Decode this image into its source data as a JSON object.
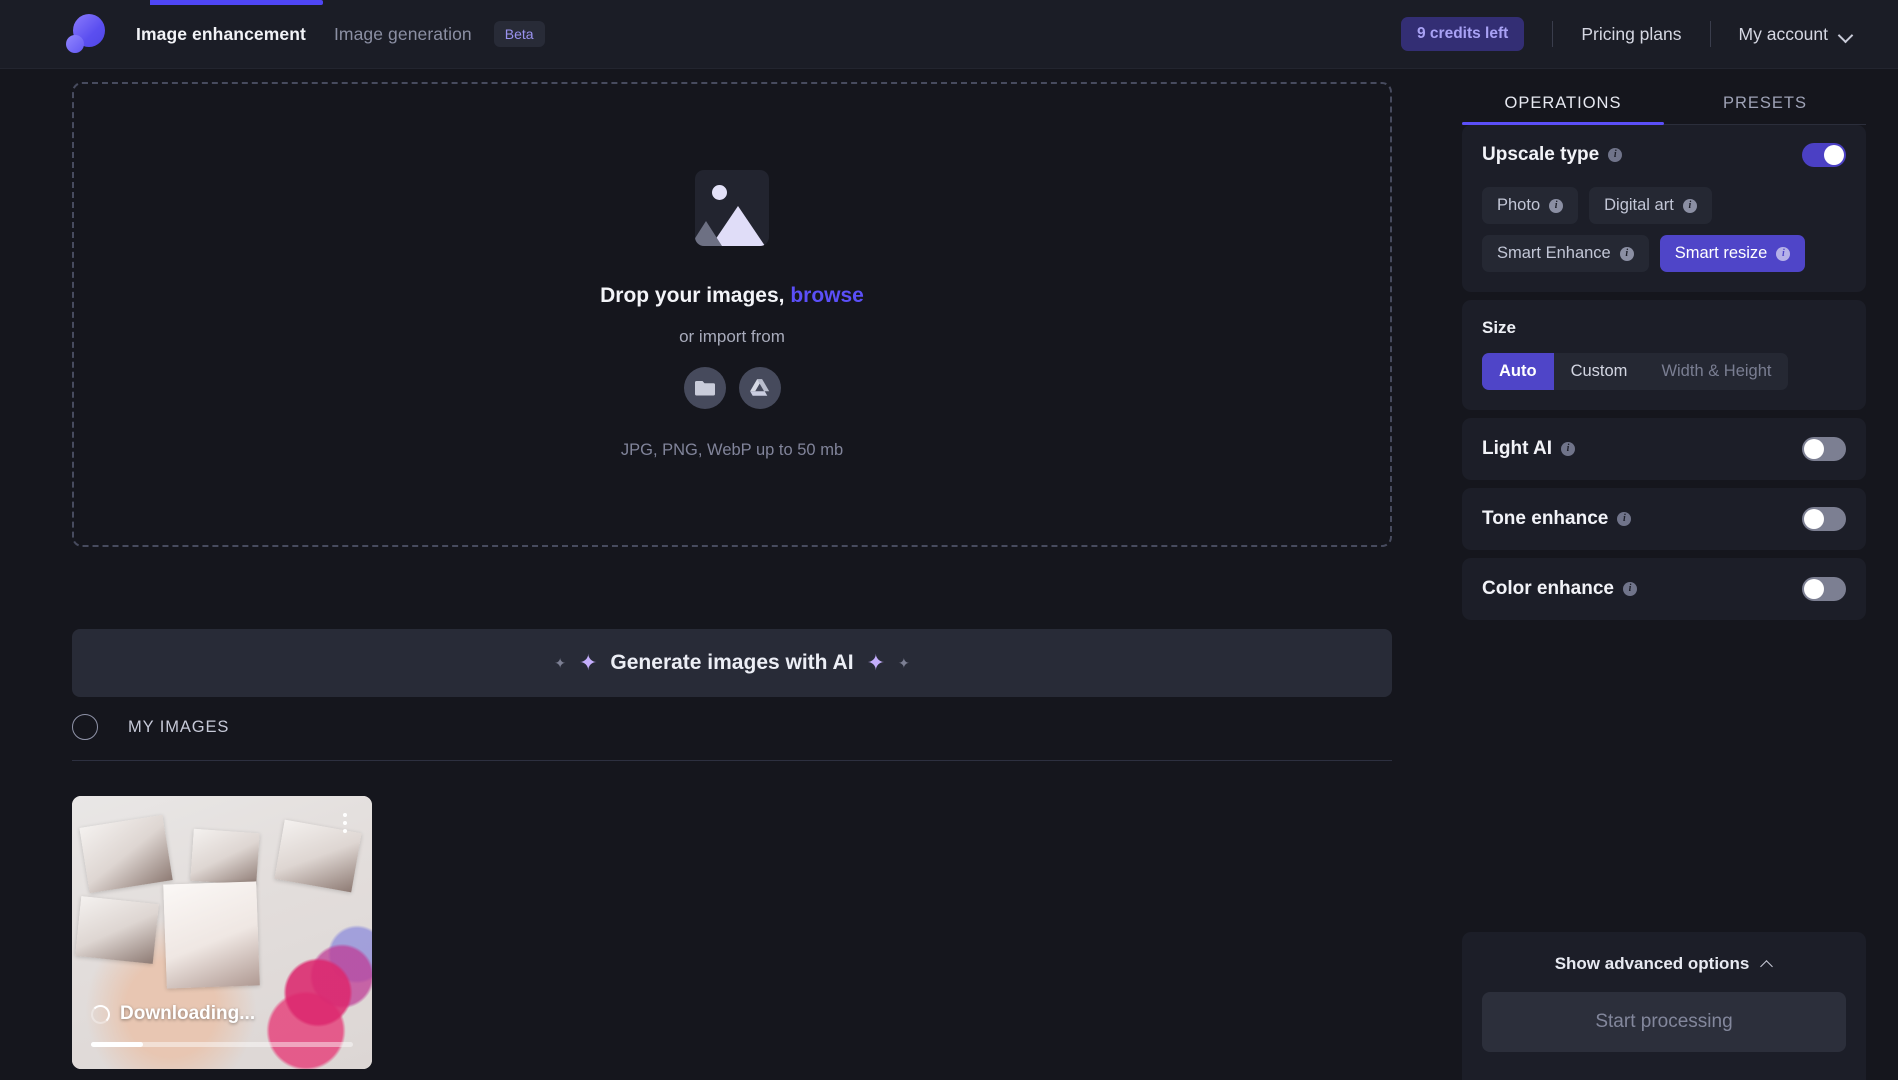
{
  "topbar": {
    "progress_percent": 18
  },
  "header": {
    "logo_name": "app-logo",
    "nav": [
      {
        "label": "Image enhancement",
        "active": true
      },
      {
        "label": "Image generation",
        "active": false
      }
    ],
    "beta_badge": "Beta",
    "credits": "9 credits left",
    "pricing_link": "Pricing plans",
    "account_link": "My account"
  },
  "dropzone": {
    "title_main": "Drop your images,",
    "title_link": "browse",
    "subtitle": "or import from",
    "import_sources": [
      {
        "name": "folder-icon"
      },
      {
        "name": "google-drive-icon"
      }
    ],
    "formats": "JPG, PNG, WebP up to 50 mb"
  },
  "ai_banner": {
    "label": "Generate images with AI"
  },
  "my_images": {
    "label": "MY IMAGES",
    "cards": [
      {
        "status": "Downloading...",
        "progress_percent": 20,
        "menu": "more-options"
      }
    ]
  },
  "panel": {
    "tabs": [
      {
        "label": "OPERATIONS",
        "active": true
      },
      {
        "label": "PRESETS",
        "active": false
      }
    ],
    "upscale": {
      "title": "Upscale type",
      "enabled": true,
      "chips": [
        {
          "label": "Photo",
          "selected": false
        },
        {
          "label": "Digital art",
          "selected": false
        },
        {
          "label": "Smart Enhance",
          "selected": false
        },
        {
          "label": "Smart resize",
          "selected": true
        }
      ]
    },
    "size": {
      "title": "Size",
      "options": [
        {
          "label": "Auto",
          "active": true,
          "muted": false
        },
        {
          "label": "Custom",
          "active": false,
          "muted": false
        },
        {
          "label": "Width & Height",
          "active": false,
          "muted": true
        }
      ]
    },
    "toggles": [
      {
        "label": "Light AI",
        "on": false
      },
      {
        "label": "Tone enhance",
        "on": false
      },
      {
        "label": "Color enhance",
        "on": false
      }
    ],
    "advanced_label": "Show advanced options",
    "start_label": "Start processing"
  },
  "colors": {
    "accent": "#5b4ff8",
    "accent_dark": "#4f45c8",
    "bg": "#15161d",
    "card_bg": "#1c1e28",
    "header_bg": "#1b1d26"
  }
}
